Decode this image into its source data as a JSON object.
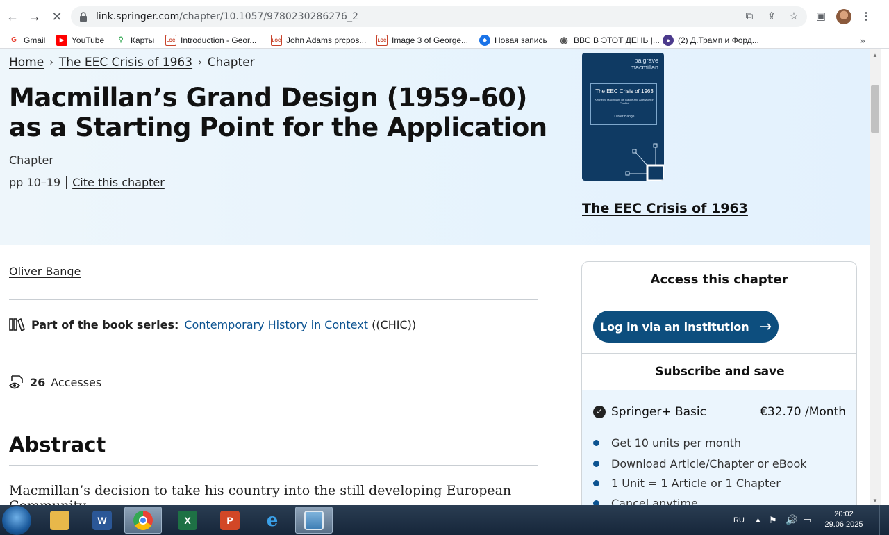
{
  "browser": {
    "url_host": "link.springer.com",
    "url_path": "/chapter/10.1057/9780230286276_2",
    "bookmarks": [
      {
        "label": "Gmail",
        "color": "#ea4335",
        "glyph": "G"
      },
      {
        "label": "YouTube",
        "color": "#ff0000",
        "glyph": "▶"
      },
      {
        "label": "Карты",
        "color": "#34a853",
        "glyph": "⬤"
      },
      {
        "label": "Introduction - Geor...",
        "color": "#c8432b",
        "glyph": "LOC"
      },
      {
        "label": "John Adams prcpos...",
        "color": "#c8432b",
        "glyph": "LOC"
      },
      {
        "label": "Image 3 of George...",
        "color": "#c8432b",
        "glyph": "LOC"
      },
      {
        "label": "Новая запись",
        "color": "#1a73e8",
        "glyph": "◆"
      },
      {
        "label": "BBC В ЭТОТ ДЕНЬ |...",
        "color": "#555555",
        "glyph": "◉"
      },
      {
        "label": "(2) Д.Трамп и Форд...",
        "color": "#4b3a8c",
        "glyph": "👤"
      }
    ],
    "more_bookmarks": "»"
  },
  "breadcrumb": {
    "home": "Home",
    "book": "The EEC Crisis of 1963",
    "current": "Chapter"
  },
  "chapter": {
    "title": "Macmillan’s Grand Design (1959–60) as a Starting Point for the Application",
    "type": "Chapter",
    "pages": "pp 10–19",
    "cite": "Cite this chapter"
  },
  "cover": {
    "publisher_line1": "palgrave",
    "publisher_line2": "macmillan",
    "title": "The EEC Crisis of 1963",
    "subtitle": "Kennedy, Macmillan, de Gaulle and Adenauer in Conflict",
    "author": "Oliver Bange"
  },
  "book_link": "The EEC Crisis of 1963",
  "author": "Oliver Bange",
  "series": {
    "label": "Part of the book series:",
    "name": "Contemporary History in Context",
    "abbr": "((CHIC))"
  },
  "accesses": {
    "count": "26",
    "label": "Accesses"
  },
  "abstract": {
    "heading": "Abstract",
    "text": "Macmillan’s decision to take his country into the still developing European Community"
  },
  "panel": {
    "access_heading": "Access this chapter",
    "login_label": "Log in via an institution",
    "subscribe_heading": "Subscribe and save",
    "plan_name": "Springer+ Basic",
    "plan_price": "€32.70 /Month",
    "features": [
      "Get 10 units per month",
      "Download Article/Chapter or eBook",
      "1 Unit = 1 Article or 1 Chapter",
      "Cancel anytime"
    ]
  },
  "taskbar": {
    "lang": "RU",
    "time": "20:02",
    "date": "29.06.2025"
  }
}
